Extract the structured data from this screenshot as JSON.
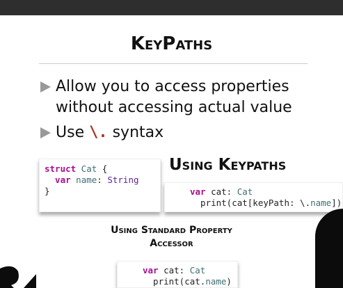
{
  "slide": {
    "title": "KeyPaths",
    "bullets": [
      {
        "text": "Allow you to access properties without accessing actual value"
      },
      {
        "pre": "Use ",
        "code": "\\.",
        "post": " syntax"
      }
    ],
    "struct_code": {
      "line1_kw": "struct",
      "line1_type": " Cat",
      "line1_rest": " {",
      "line2_kw": "  var",
      "line2_name": " name",
      "line2_colon": ": ",
      "line2_type": "String",
      "line3": "}"
    },
    "keypath_heading": "Using Keypaths",
    "keypath_code": {
      "l1_kw": "var",
      "l1_rest": " cat: ",
      "l1_type": "Cat",
      "l2_a": "  print(cat[keyPath: \\.",
      "l2_prop": "name",
      "l2_b": "])"
    },
    "standard_heading_line1": "Using Standard Property",
    "standard_heading_line2": "Accessor",
    "standard_code": {
      "l1_kw": "var",
      "l1_rest": " cat: ",
      "l1_type": "Cat",
      "l2_a": "  print(cat.",
      "l2_prop": "name",
      "l2_b": ")"
    }
  },
  "colors": {
    "keyword": "#aa0d91",
    "type": "#3f6e74",
    "accent": "#b0301e"
  }
}
